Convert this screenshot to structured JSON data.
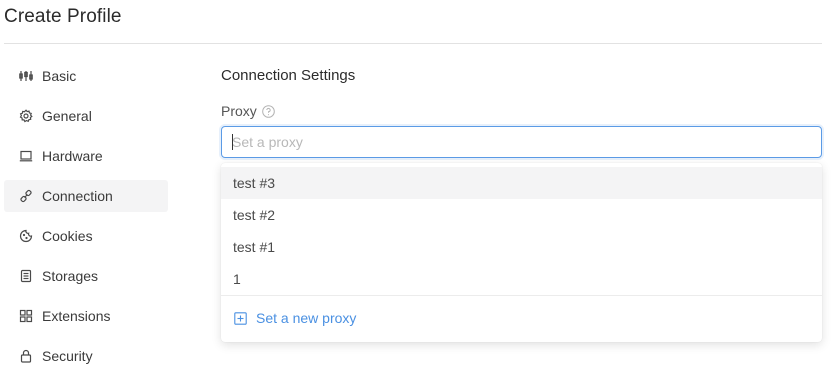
{
  "page": {
    "title": "Create Profile"
  },
  "sidebar": {
    "items": [
      {
        "label": "Basic",
        "icon": "sliders-icon"
      },
      {
        "label": "General",
        "icon": "gear-icon"
      },
      {
        "label": "Hardware",
        "icon": "laptop-icon"
      },
      {
        "label": "Connection",
        "icon": "link-icon",
        "active": true
      },
      {
        "label": "Cookies",
        "icon": "cookie-icon"
      },
      {
        "label": "Storages",
        "icon": "storage-icon"
      },
      {
        "label": "Extensions",
        "icon": "extensions-icon"
      },
      {
        "label": "Security",
        "icon": "lock-icon"
      }
    ]
  },
  "main": {
    "section_title": "Connection Settings",
    "proxy": {
      "label": "Proxy",
      "placeholder": "Set a proxy",
      "value": "",
      "options": [
        "test #3",
        "test #2",
        "test #1",
        "1"
      ],
      "highlighted_option": "test #3",
      "new_proxy_label": "Set a new proxy"
    }
  },
  "colors": {
    "accent": "#4a90e2",
    "input_border_focus": "#5b9be6",
    "active_item_bg": "#f4f4f5"
  }
}
